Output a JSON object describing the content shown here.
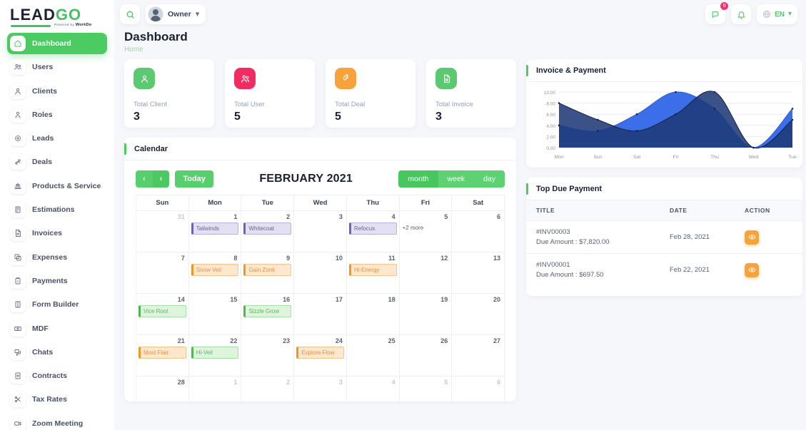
{
  "brand": {
    "lead": "LEAD",
    "go": "GO",
    "powered": "Powered by ",
    "workdo": "WorkDo"
  },
  "sidebar": {
    "items": [
      {
        "label": "Dashboard",
        "icon": "home-icon",
        "active": true
      },
      {
        "label": "Users",
        "icon": "users-icon",
        "active": false
      },
      {
        "label": "Clients",
        "icon": "user-icon",
        "active": false
      },
      {
        "label": "Roles",
        "icon": "user-role-icon",
        "active": false
      },
      {
        "label": "Leads",
        "icon": "target-icon",
        "active": false
      },
      {
        "label": "Deals",
        "icon": "handshake-icon",
        "active": false
      },
      {
        "label": "Products & Service",
        "icon": "box-icon",
        "active": false
      },
      {
        "label": "Estimations",
        "icon": "calculator-icon",
        "active": false
      },
      {
        "label": "Invoices",
        "icon": "file-icon",
        "active": false
      },
      {
        "label": "Expenses",
        "icon": "copy-icon",
        "active": false
      },
      {
        "label": "Payments",
        "icon": "wallet-icon",
        "active": false
      },
      {
        "label": "Form Builder",
        "icon": "book-icon",
        "active": false
      },
      {
        "label": "MDF",
        "icon": "money-icon",
        "active": false
      },
      {
        "label": "Chats",
        "icon": "chat-icon",
        "active": false
      },
      {
        "label": "Contracts",
        "icon": "contract-icon",
        "active": false
      },
      {
        "label": "Tax Rates",
        "icon": "scissors-icon",
        "active": false
      },
      {
        "label": "Zoom Meeting",
        "icon": "video-icon",
        "active": false
      }
    ]
  },
  "topbar": {
    "search_icon": "search-icon",
    "owner_label": "Owner",
    "chevron": "⌄",
    "messages_badge": "0",
    "language": "EN"
  },
  "page": {
    "title": "Dashboard",
    "breadcrumb": "Home"
  },
  "stats": [
    {
      "label": "Total Client",
      "value": "3",
      "color": "#5ac96f",
      "icon": "user-icon"
    },
    {
      "label": "Total User",
      "value": "5",
      "color": "#f32b63",
      "icon": "users-icon"
    },
    {
      "label": "Total Deal",
      "value": "5",
      "color": "#f7a23b",
      "icon": "rocket-icon"
    },
    {
      "label": "Total Invoice",
      "value": "3",
      "color": "#5ac96f",
      "icon": "file-icon"
    }
  ],
  "calendar": {
    "panel_title": "Calendar",
    "prev_label": "‹",
    "next_label": "›",
    "today_label": "Today",
    "title": "FEBRUARY 2021",
    "views": [
      {
        "label": "month",
        "active": true
      },
      {
        "label": "week",
        "active": false
      },
      {
        "label": "day",
        "active": false
      }
    ],
    "weekdays": [
      "Sun",
      "Mon",
      "Tue",
      "Wed",
      "Thu",
      "Fri",
      "Sat"
    ],
    "weeks": [
      [
        {
          "day": "31",
          "muted": true,
          "events": []
        },
        {
          "day": "1",
          "muted": false,
          "events": [
            {
              "title": "Tailwinds",
              "color": "purple"
            }
          ]
        },
        {
          "day": "2",
          "muted": false,
          "events": [
            {
              "title": "Whitecoat",
              "color": "purple"
            }
          ]
        },
        {
          "day": "3",
          "muted": false,
          "events": []
        },
        {
          "day": "4",
          "muted": false,
          "events": [
            {
              "title": "Refocus",
              "color": "purple"
            }
          ]
        },
        {
          "day": "5",
          "muted": false,
          "events": [],
          "more": "+2 more"
        },
        {
          "day": "6",
          "muted": false,
          "events": []
        }
      ],
      [
        {
          "day": "7",
          "muted": false,
          "events": []
        },
        {
          "day": "8",
          "muted": false,
          "events": [
            {
              "title": "Snow Veil",
              "color": "orange"
            }
          ]
        },
        {
          "day": "9",
          "muted": false,
          "events": [
            {
              "title": "Gain Zonk",
              "color": "orange"
            }
          ]
        },
        {
          "day": "10",
          "muted": false,
          "events": []
        },
        {
          "day": "11",
          "muted": false,
          "events": [
            {
              "title": "Hi-Energy",
              "color": "orange"
            }
          ]
        },
        {
          "day": "12",
          "muted": false,
          "events": []
        },
        {
          "day": "13",
          "muted": false,
          "events": []
        }
      ],
      [
        {
          "day": "14",
          "muted": false,
          "events": [
            {
              "title": "Vice Root",
              "color": "green"
            }
          ]
        },
        {
          "day": "15",
          "muted": false,
          "events": []
        },
        {
          "day": "16",
          "muted": false,
          "events": [
            {
              "title": "Sizzle Grow",
              "color": "green"
            }
          ]
        },
        {
          "day": "17",
          "muted": false,
          "events": []
        },
        {
          "day": "18",
          "muted": false,
          "events": []
        },
        {
          "day": "19",
          "muted": false,
          "events": []
        },
        {
          "day": "20",
          "muted": false,
          "events": []
        }
      ],
      [
        {
          "day": "21",
          "muted": false,
          "events": [
            {
              "title": "Most Flair",
              "color": "orange"
            }
          ]
        },
        {
          "day": "22",
          "muted": false,
          "events": [
            {
              "title": "Hi-Veil",
              "color": "green"
            }
          ]
        },
        {
          "day": "23",
          "muted": false,
          "events": []
        },
        {
          "day": "24",
          "muted": false,
          "events": [
            {
              "title": "Explore Flow",
              "color": "orange"
            }
          ]
        },
        {
          "day": "25",
          "muted": false,
          "events": []
        },
        {
          "day": "26",
          "muted": false,
          "events": []
        },
        {
          "day": "27",
          "muted": false,
          "events": []
        }
      ],
      [
        {
          "day": "28",
          "muted": false,
          "events": []
        },
        {
          "day": "1",
          "muted": true,
          "events": []
        },
        {
          "day": "2",
          "muted": true,
          "events": []
        },
        {
          "day": "3",
          "muted": true,
          "events": []
        },
        {
          "day": "4",
          "muted": true,
          "events": []
        },
        {
          "day": "5",
          "muted": true,
          "events": []
        },
        {
          "day": "6",
          "muted": true,
          "events": []
        }
      ]
    ]
  },
  "invoice_chart": {
    "panel_title": "Invoice & Payment"
  },
  "chart_data": {
    "type": "area",
    "title": "Invoice & Payment",
    "categories": [
      "Mon",
      "Sun",
      "Sat",
      "Fri",
      "Thu",
      "Wed",
      "Tue"
    ],
    "series": [
      {
        "name": "Invoice",
        "color": "#1f3a78",
        "values": [
          8,
          5,
          3,
          6,
          10,
          0,
          5
        ]
      },
      {
        "name": "Payment",
        "color": "#3b6ee8",
        "values": [
          4,
          3,
          6,
          10,
          7,
          0,
          7
        ]
      }
    ],
    "ylim": [
      0,
      10
    ],
    "yticks": [
      "0.00",
      "2.00",
      "4.00",
      "6.00",
      "8.00",
      "10.00"
    ],
    "xlabel": "",
    "ylabel": "",
    "grid": true,
    "legend": "none"
  },
  "due": {
    "panel_title": "Top Due Payment",
    "columns": [
      "TITLE",
      "DATE",
      "ACTION"
    ],
    "rows": [
      {
        "invoice": "#INV00003",
        "amount": "Due Amount : $7,820.00",
        "date": "Feb 28, 2021",
        "action": "view-icon"
      },
      {
        "invoice": "#INV00001",
        "amount": "Due Amount : $697.50",
        "date": "Feb 22, 2021",
        "action": "view-icon"
      }
    ]
  }
}
